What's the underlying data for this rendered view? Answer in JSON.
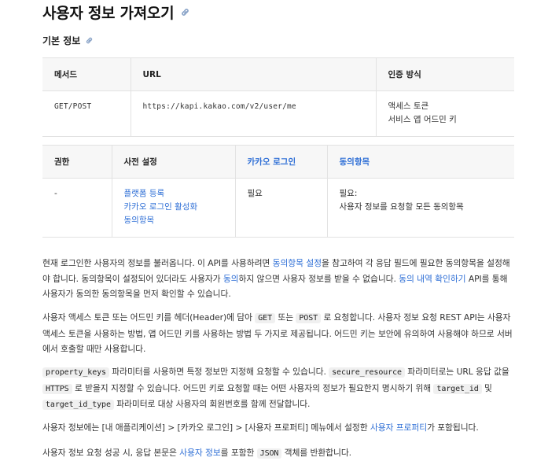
{
  "page": {
    "title": "사용자 정보 가져오기"
  },
  "section": {
    "title": "기본 정보"
  },
  "table1": {
    "headers": [
      "메서드",
      "URL",
      "인증 방식"
    ],
    "method": "GET/POST",
    "url": "https://kapi.kakao.com/v2/user/me",
    "auth_line1": "액세스 토큰",
    "auth_line2": "서비스 앱 어드민 키"
  },
  "table2": {
    "headers": [
      "권한",
      "사전 설정",
      "카카오 로그인",
      "동의항목"
    ],
    "permission": "-",
    "presetting": [
      "플랫폼 등록",
      "카카오 로그인 활성화",
      "동의항목"
    ],
    "kakao_login": "필요",
    "consent_line1": "필요:",
    "consent_line2": "사용자 정보를 요청할 모든 동의항목"
  },
  "p1": {
    "t1": "현재 로그인한 사용자의 정보를 불러옵니다. 이 API를 사용하려면 ",
    "l1": "동의항목 설정",
    "t2": "을 참고하여 각 응답 필드에 필요한 동의항목을 설정해야 합니다. 동의항목이 설정되어 있더라도 사용자가 ",
    "l2": "동의",
    "t3": "하지 않으면 사용자 정보를 받을 수 없습니다. ",
    "l3": "동의 내역 확인하기",
    "t4": " API를 통해 사용자가 동의한 동의항목을 먼저 확인할 수 있습니다."
  },
  "p2": {
    "t1": "사용자 액세스 토큰 또는 어드민 키를 헤더(Header)에 담아 ",
    "c1": "GET",
    "t2": " 또는 ",
    "c2": "POST",
    "t3": " 로 요청합니다. 사용자 정보 요청 REST API는 사용자 액세스 토큰을 사용하는 방법, 앱 어드민 키를 사용하는 방법 두 가지로 제공됩니다. 어드민 키는 보안에 유의하여 사용해야 하므로 서버에서 호출할 때만 사용합니다."
  },
  "p3": {
    "c1": "property_keys",
    "t1": " 파라미터를 사용하면 특정 정보만 지정해 요청할 수 있습니다. ",
    "c2": "secure_resource",
    "t2": " 파라미터로는 URL 응답 값을 ",
    "c3": "HTTPS",
    "t3": " 로 받을지 지정할 수 있습니다. 어드민 키로 요청할 때는 어떤 사용자의 정보가 필요한지 명시하기 위해 ",
    "c4": "target_id",
    "t4": " 및 ",
    "c5": "target_id_type",
    "t5": " 파라미터로 대상 사용자의 회원번호를 함께 전달합니다."
  },
  "p4": {
    "t1": "사용자 정보에는 [내 애플리케이션] > [카카오 로그인] > [사용자 프로퍼티] 메뉴에서 설정한 ",
    "l1": "사용자 프로퍼티",
    "t2": "가 포함됩니다."
  },
  "p5": {
    "t1": "사용자 정보 요청 성공 시, 응답 본문은 ",
    "l1": "사용자 정보",
    "t2": "를 포함한 ",
    "c1": "JSON",
    "t3": " 객체를 반환합니다."
  },
  "colors": {
    "link": "#2f6fd6",
    "header_bg": "#f7f7f7",
    "border": "#e2e2e2",
    "code_bg": "#f0f0f0"
  },
  "icons": {
    "anchor": "link-icon"
  }
}
